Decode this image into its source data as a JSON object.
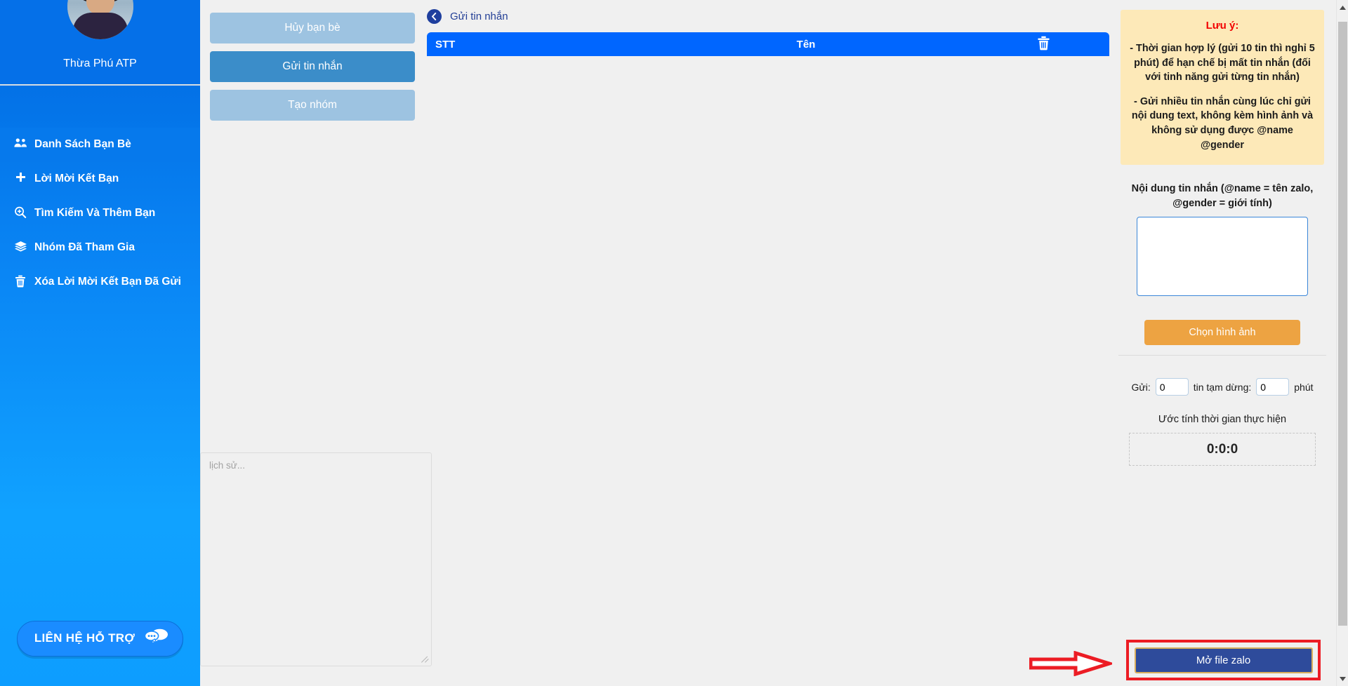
{
  "sidebar": {
    "profile": {
      "name": "Thừa Phú ATP",
      "avatar_icon": "user-avatar-photo"
    },
    "items": [
      {
        "label": "Danh Sách Bạn Bè",
        "icon": "users-icon",
        "active": true
      },
      {
        "label": "Lời Mời Kết Bạn",
        "icon": "plus-icon",
        "active": false
      },
      {
        "label": "Tìm Kiếm Và Thêm Bạn",
        "icon": "search-plus-icon",
        "active": false
      },
      {
        "label": "Nhóm Đã Tham Gia",
        "icon": "layers-icon",
        "active": false
      },
      {
        "label": "Xóa Lời Mời Kết Bạn Đã Gửi",
        "icon": "trash-icon",
        "active": false
      }
    ],
    "support_button": {
      "label": "LIÊN HỆ HỖ TRỢ",
      "icon": "chat-bubbles-icon"
    }
  },
  "action_buttons": [
    {
      "label": "Hủy bạn bè",
      "active": false
    },
    {
      "label": "Gửi tin nhắn",
      "active": true
    },
    {
      "label": "Tạo nhóm",
      "active": false
    }
  ],
  "history": {
    "placeholder": "lịch sử...",
    "value": ""
  },
  "center": {
    "breadcrumb": {
      "back_icon": "back-arrow-circle-icon",
      "title": "Gửi tin nhắn"
    },
    "table": {
      "columns": [
        "STT",
        "Tên",
        "trash-icon"
      ],
      "rows": []
    }
  },
  "right": {
    "note": {
      "title": "Lưu ý:",
      "lines": [
        "- Thời gian hợp lý (gửi 10 tin thì nghỉ 5 phút) để hạn chế bị mất tin nhắn (đối với tinh năng gửi từng tin nhắn)",
        "- Gửi nhiều tin nhắn cùng lúc chỉ gửi nội dung text, không kèm hình ảnh và không sử dụng được @name @gender"
      ]
    },
    "message_label": "Nội dung tin nhắn (@name = tên zalo, @gender = giới tính)",
    "message_textarea": {
      "value": "",
      "placeholder": ""
    },
    "pick_image_button": "Chọn hình ảnh",
    "rate": {
      "send_label": "Gửi:",
      "send_value": "0",
      "pause_label": "tin tạm dừng:",
      "pause_value": "0",
      "unit_label": "phút"
    },
    "estimate_label": "Ước tính thời gian thực hiện",
    "estimate_value": "0:0:0",
    "open_zalo_button": "Mở file zalo",
    "annotation_arrow": "red-arrow-pointing-right"
  },
  "colors": {
    "sidebar_top": "#0068e0",
    "sidebar_bottom": "#0d9dff",
    "table_header": "#0066ff",
    "note_bg": "#fde9b8",
    "note_title": "#f20000",
    "pick_image": "#eda342",
    "zalo_button": "#2e4b9b",
    "zalo_border": "#d9ae5c",
    "highlight_red": "#ec1c24",
    "active_tab": "#3b8dc9",
    "inactive_tab": "#9dc3e1"
  },
  "scrollbar": {
    "up_icon": "caret-up-icon",
    "down_icon": "caret-down-icon"
  }
}
